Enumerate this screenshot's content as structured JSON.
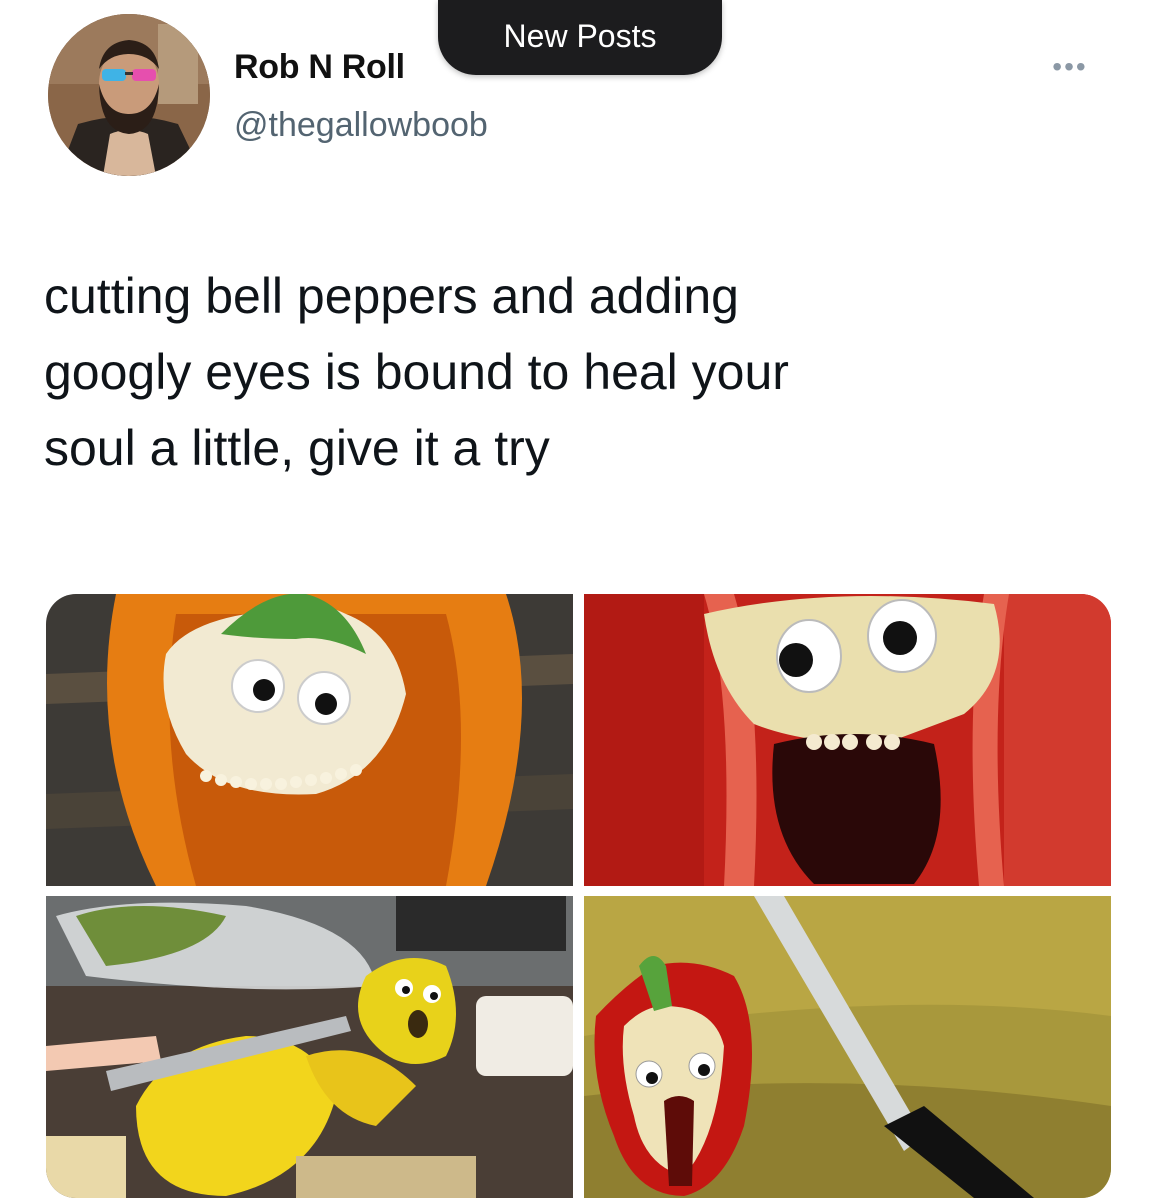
{
  "header": {
    "display_name": "Rob N Roll",
    "handle": "@thegallowboob",
    "new_posts_label": "New Posts",
    "more_icon": "more-options-icon"
  },
  "tweet": {
    "lines": [
      "cutting bell peppers and adding",
      "googly eyes is bound to heal your",
      "soul a little, give it a try"
    ]
  },
  "media": {
    "photos": [
      {
        "subject": "orange bell pepper half with googly eyes"
      },
      {
        "subject": "red bell pepper close-up with googly eyes"
      },
      {
        "subject": "yellow bell pepper with googly eyes being sliced"
      },
      {
        "subject": "red bell pepper half with googly eyes next to a knife"
      }
    ]
  },
  "colors": {
    "new_posts_bg": "#1c1c1e",
    "handle": "#536471",
    "text": "#0f1419"
  }
}
